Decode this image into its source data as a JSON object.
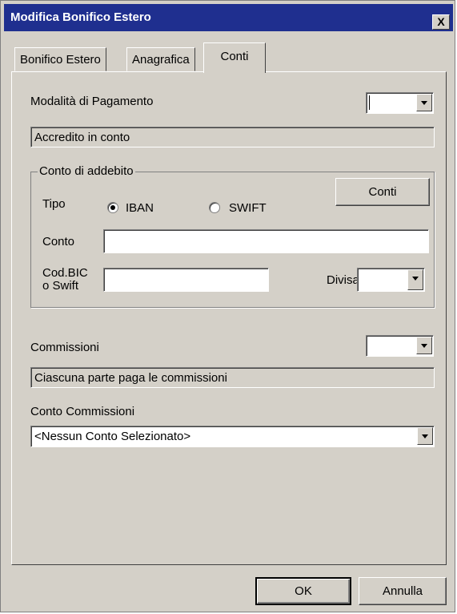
{
  "window": {
    "title": "Modifica Bonifico Estero",
    "close_label": "X"
  },
  "tabs": [
    {
      "label": "Bonifico Estero",
      "active": false
    },
    {
      "label": "Anagrafica",
      "active": false
    },
    {
      "label": "Conti",
      "active": true
    }
  ],
  "payment": {
    "label": "Modalità di Pagamento",
    "combo_value": "",
    "description": "Accredito in conto"
  },
  "debit_group": {
    "title": "Conto di addebito",
    "conti_button": "Conti",
    "tipo_label": "Tipo",
    "radio_iban": {
      "label": "IBAN",
      "checked": true
    },
    "radio_swift": {
      "label": "SWIFT",
      "checked": false
    },
    "conto_label": "Conto",
    "conto_value": "",
    "bic_label_line1": "Cod.BIC",
    "bic_label_line2": "o Swift",
    "bic_value": "",
    "divisa_label": "Divisa",
    "divisa_value": ""
  },
  "commissions": {
    "label": "Commissioni",
    "combo_value": "",
    "description": "Ciascuna parte paga le commissioni",
    "account_label": "Conto Commissioni",
    "account_value": "<Nessun Conto Selezionato>"
  },
  "footer": {
    "ok_label": "OK",
    "cancel_label": "Annulla"
  }
}
